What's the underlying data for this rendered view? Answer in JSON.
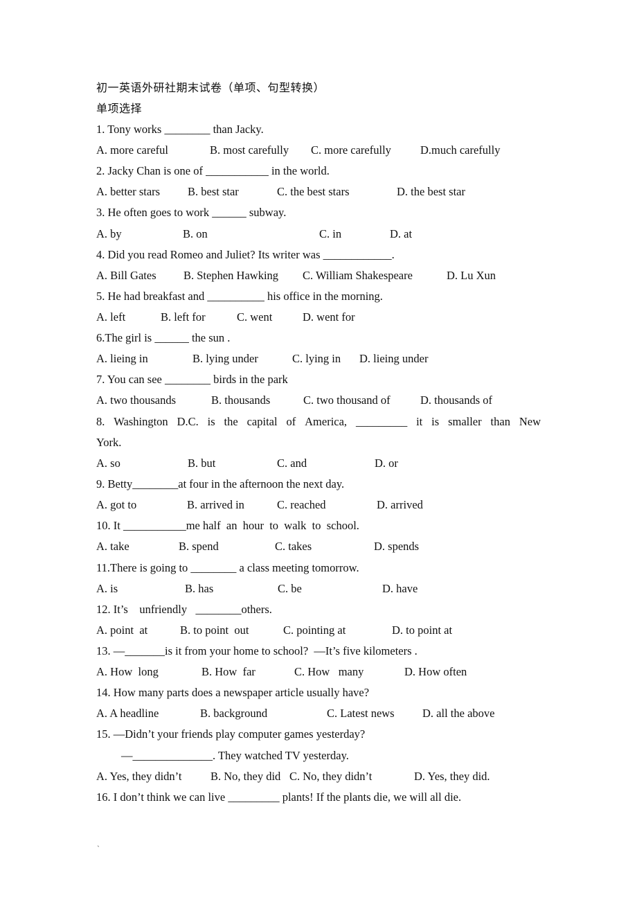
{
  "document": {
    "title": "初一英语外研社期末试卷（单项、句型转换）",
    "section_heading": "单项选择",
    "questions": [
      {
        "stem": "1. Tony works ________ than Jacky.",
        "options": [
          "A. more careful",
          "B. most carefully",
          "C. more carefully",
          "D.much carefully"
        ]
      },
      {
        "stem": "2. Jacky Chan is one of ___________ in the world.",
        "options": [
          "A. better stars",
          "B. best star",
          "C. the best stars",
          "D. the best star"
        ]
      },
      {
        "stem": "3. He often goes to work ______ subway.",
        "options": [
          "A. by",
          "B. on",
          "C. in",
          "D. at"
        ]
      },
      {
        "stem": "4. Did you read Romeo and Juliet? Its writer was ____________.",
        "options": [
          "A. Bill Gates",
          "B. Stephen Hawking",
          "C. William Shakespeare",
          "D. Lu Xun"
        ]
      },
      {
        "stem": "5. He had breakfast and __________ his office in the morning.",
        "options": [
          "A. left",
          "B. left for",
          "C. went",
          "D. went for"
        ]
      },
      {
        "stem": "6.The girl is ______ the sun .",
        "options": [
          "A. lieing in",
          "B. lying under",
          "C. lying in",
          "D. lieing under"
        ]
      },
      {
        "stem": "7. You can see ________ birds in the park",
        "options": [
          "A. two thousands",
          "B. thousands",
          "C. two thousand of",
          "D. thousands of"
        ]
      },
      {
        "stem_words": [
          "8.",
          "Washington",
          "D.C.",
          "is",
          "the",
          "capital",
          "of",
          "America,",
          "_________",
          "it",
          "is",
          "smaller",
          "than",
          "New"
        ],
        "stem_continued": "York.",
        "options": [
          "A. so",
          "B. but",
          "C. and",
          "D. or"
        ]
      },
      {
        "stem": "9. Betty________at four in the afternoon the next day.",
        "options": [
          "A. got to",
          "B. arrived in",
          "C. reached",
          "D. arrived"
        ]
      },
      {
        "stem": "10. It ___________me half  an  hour  to  walk  to  school.",
        "options": [
          "A. take",
          "B. spend",
          "C. takes",
          "D. spends"
        ]
      },
      {
        "stem": "11.There is going to ________ a class meeting tomorrow.",
        "options": [
          "A. is",
          "B. has",
          "C. be",
          "D. have"
        ]
      },
      {
        "stem": "12. It’s    unfriendly   ________others.",
        "options": [
          "A. point  at",
          "B. to point  out",
          "C. pointing at",
          "D. to point at"
        ]
      },
      {
        "stem": "13. —_______is it from your home to school?  —It’s five kilometers .",
        "options": [
          "A. How  long",
          "B. How  far",
          "C. How   many",
          "D. How often"
        ]
      },
      {
        "stem": "14. How many parts does a newspaper article usually have?",
        "options": [
          "A. A headline",
          "B. background",
          "C. Latest news",
          "D. all the above"
        ]
      },
      {
        "stem": "15. —Didn’t your friends play computer games yesterday?",
        "stem_continued": "—______________. They watched TV yesterday.",
        "options": [
          "A. Yes, they didn’t",
          "B. No, they did",
          "C. No, they didn’t",
          "D. Yes, they did."
        ]
      },
      {
        "stem": "16. I don’t think we can live _________ plants! If the plants die, we will all die."
      }
    ],
    "footer_mark": "`"
  }
}
